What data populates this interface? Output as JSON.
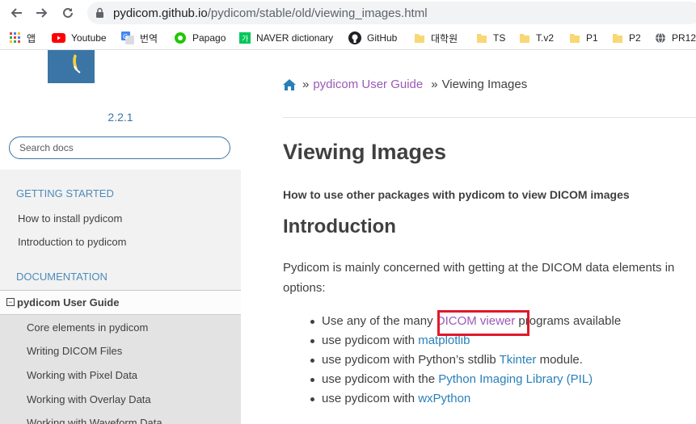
{
  "browser": {
    "url_host": "pydicom.github.io",
    "url_path": "/pydicom/stable/old/viewing_images.html",
    "bookmarks": [
      {
        "label": "앱",
        "icon": "apps-grid-icon"
      },
      {
        "label": "Youtube",
        "icon": "youtube-icon"
      },
      {
        "label": "번역",
        "icon": "google-translate-icon"
      },
      {
        "label": "Papago",
        "icon": "papago-icon"
      },
      {
        "label": "NAVER dictionary",
        "icon": "naver-dictionary-icon"
      },
      {
        "label": "GitHub",
        "icon": "github-icon"
      },
      {
        "label": "대학원",
        "icon": "folder-icon"
      },
      {
        "label": "TS",
        "icon": "folder-icon"
      },
      {
        "label": "T.v2",
        "icon": "folder-icon"
      },
      {
        "label": "P1",
        "icon": "folder-icon"
      },
      {
        "label": "P2",
        "icon": "folder-icon"
      },
      {
        "label": "PR12",
        "icon": "globe-icon"
      }
    ]
  },
  "sidebar": {
    "version": "2.2.1",
    "search_placeholder": "Search docs",
    "caption_getting_started": "GETTING STARTED",
    "getting_started_links": [
      "How to install pydicom",
      "Introduction to pydicom"
    ],
    "caption_documentation": "DOCUMENTATION",
    "current_section": "pydicom User Guide",
    "current_section_toggle": "−",
    "sub_items": [
      "Core elements in pydicom",
      "Writing DICOM Files",
      "Working with Pixel Data",
      "Working with Overlay Data",
      "Working with Waveform Data"
    ]
  },
  "main": {
    "breadcrumb_sep": "»",
    "breadcrumb_link": "pydicom User Guide",
    "breadcrumb_current": "Viewing Images",
    "title": "Viewing Images",
    "subtitle": "How to use other packages with pydicom to view DICOM images",
    "intro_heading": "Introduction",
    "intro_para": "Pydicom is mainly concerned with getting at the DICOM data elements in options:",
    "bullets": [
      {
        "before": "Use any of the many ",
        "link": "DICOM viewer",
        "after": " programs available"
      },
      {
        "before": "use pydicom with ",
        "link": "matplotlib",
        "after": ""
      },
      {
        "before": "use pydicom with Python’s stdlib ",
        "link": "Tkinter",
        "after": " module."
      },
      {
        "before": "use pydicom with the ",
        "link": "Python Imaging Library (PIL)",
        "after": ""
      },
      {
        "before": "use pydicom with ",
        "link": "wxPython",
        "after": ""
      }
    ]
  },
  "colors": {
    "accent": "#2980b9",
    "visited": "#9b59b6",
    "sidebar_caption": "#4d8bb9",
    "highlight_box": "#e0182b"
  }
}
